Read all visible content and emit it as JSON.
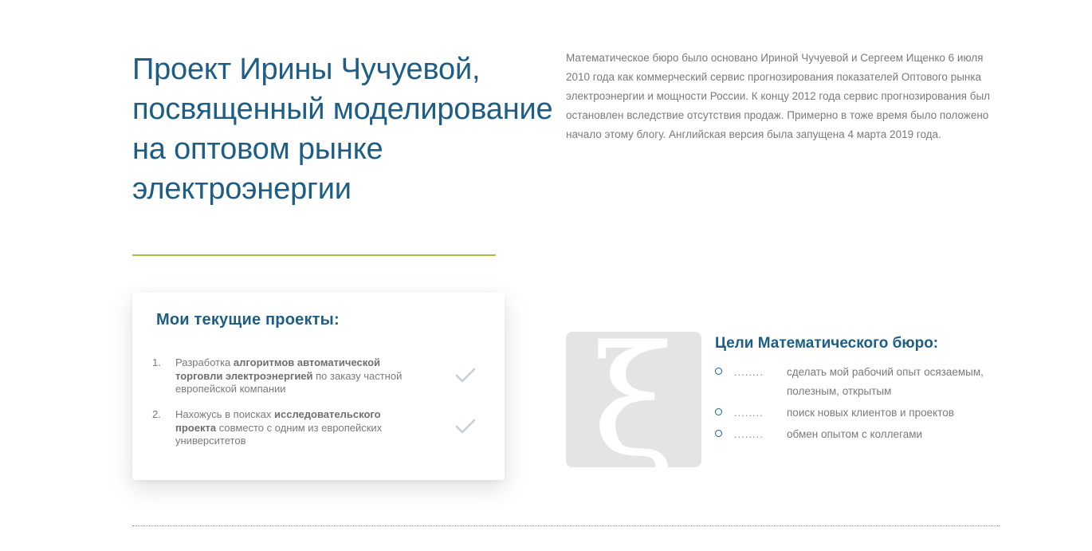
{
  "hero": {
    "title": "Проект Ирины Чучуевой, посвященный моделирование на оптовом рынке электроэнергии",
    "intro": "Математическое бюро было основано Ириной Чучуевой и Сергеем Ищенко 6 июля 2010 года как коммерческий сервис прогнозирования показателей Оптового рынка электроэнергии и мощности России. К концу 2012 года сервис прогнозирования был остановлен вследствие отсутствия продаж. Примерно в тоже время было положено начало этому блогу. Английская версия была запущена 4 марта 2019 года."
  },
  "projects": {
    "title": "Мои текущие проекты:",
    "items": [
      {
        "num": "1.",
        "pre": "Разработка ",
        "bold": "алгоритмов автоматической торговли электроэнергией",
        "post": " по заказу частной европейской компании",
        "icon": "check-icon"
      },
      {
        "num": "2.",
        "pre": "Нахожусь в поисках ",
        "bold": "исследовательского проекта",
        "post": " совместо с одним из европейских университетов",
        "icon": "check-icon"
      }
    ]
  },
  "logo": {
    "glyph": "ξ",
    "icon": "xi-logo-icon"
  },
  "goals": {
    "title": "Цели Математического бюро:",
    "dots": "........",
    "items": [
      {
        "text": "сделать мой рабочий опыт осязаемым, полезным, открытым"
      },
      {
        "text": "поиск новых клиентов и проектов"
      },
      {
        "text": "обмен опытом с коллегами"
      }
    ]
  },
  "colors": {
    "heading": "#1d5d86",
    "body_text": "#7a7a7a",
    "accent_line": "#a9bf3e",
    "logo_bg": "#e4e4e4",
    "check": "#c5d1da"
  }
}
